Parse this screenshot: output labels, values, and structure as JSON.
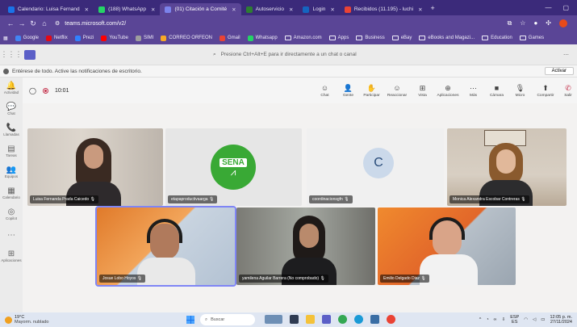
{
  "browser": {
    "tabs": [
      {
        "label": "Calendario: Luisa Fernand",
        "color": "#1a73e8"
      },
      {
        "label": "(188) WhatsApp",
        "color": "#25d366"
      },
      {
        "label": "(01) Citación a Comité",
        "color": "#5b5fc7",
        "active": true
      },
      {
        "label": "Autoservicio",
        "color": "#2e7d32"
      },
      {
        "label": "Login",
        "color": "#1565c0"
      },
      {
        "label": "Recibidos (11.195) - luchi",
        "color": "#ea4335"
      }
    ],
    "url": "teams.microsoft.com/v2/",
    "bookmarks": [
      {
        "label": "Google",
        "color": "#4285f4"
      },
      {
        "label": "Netflix",
        "color": "#e50914"
      },
      {
        "label": "Prezi",
        "color": "#3181ff"
      },
      {
        "label": "YouTube",
        "color": "#ff0000"
      },
      {
        "label": "SIMI",
        "color": "#9e9e9e"
      },
      {
        "label": "CORREO ORFEON",
        "color": "#f9a825"
      },
      {
        "label": "Gmail",
        "color": "#ea4335"
      },
      {
        "label": "Whatsapp",
        "color": "#25d366"
      },
      {
        "label": "Amazon.com",
        "folder": true
      },
      {
        "label": "Apps",
        "folder": true
      },
      {
        "label": "Business",
        "folder": true
      },
      {
        "label": "eBay",
        "folder": true
      },
      {
        "label": "eBooks and Magazi...",
        "folder": true
      },
      {
        "label": "Education",
        "folder": true
      },
      {
        "label": "Games",
        "folder": true
      }
    ]
  },
  "teams": {
    "search_placeholder": "Presione Ctrl+Alt+E para ir directamente a un chat o canal",
    "notice": "Entérese de todo. Active las notificaciones de escritorio.",
    "activate_label": "Activar",
    "rail": [
      {
        "label": "Actividad",
        "icon": "bell-icon",
        "glyph": "🔔"
      },
      {
        "label": "Chat",
        "icon": "chat-icon",
        "glyph": "💬"
      },
      {
        "label": "Llamadas",
        "icon": "phone-icon",
        "glyph": "📞"
      },
      {
        "label": "Tareas",
        "icon": "tasks-icon",
        "glyph": "▤"
      },
      {
        "label": "Equipos",
        "icon": "teams-icon",
        "glyph": "👥"
      },
      {
        "label": "Calendario",
        "icon": "calendar-icon",
        "glyph": "▦"
      },
      {
        "label": "Copilot",
        "icon": "copilot-icon",
        "glyph": "◎"
      },
      {
        "label": "",
        "icon": "more-icon",
        "glyph": "⋯"
      },
      {
        "label": "Aplicaciones",
        "icon": "apps-icon",
        "glyph": "⊞"
      }
    ],
    "meeting": {
      "timer": "10:01",
      "tools": [
        {
          "label": "Chat",
          "icon": "chat-icon",
          "glyph": "☺"
        },
        {
          "label": "Gente",
          "icon": "people-icon",
          "glyph": "👤"
        },
        {
          "label": "Participar",
          "icon": "hand-icon",
          "glyph": "✋"
        },
        {
          "label": "Reaccionar",
          "icon": "react-icon",
          "glyph": "☺"
        },
        {
          "label": "Vista",
          "icon": "view-icon",
          "glyph": "⊞"
        },
        {
          "label": "Aplicaciones",
          "icon": "apps-icon",
          "glyph": "⊕"
        },
        {
          "label": "Más",
          "icon": "more-icon",
          "glyph": "⋯"
        },
        {
          "label": "Cámara",
          "icon": "camera-icon",
          "glyph": "■"
        },
        {
          "label": "Micro",
          "icon": "mic-icon",
          "glyph": "🎙"
        },
        {
          "label": "Compartir",
          "icon": "share-icon",
          "glyph": "⬆"
        },
        {
          "label": "Salir",
          "icon": "leave-icon",
          "glyph": "✆"
        }
      ]
    },
    "participants": [
      {
        "name": "Luisa Fernanda Prada Caicedo"
      },
      {
        "name": "etapaproductivaarga"
      },
      {
        "name": "coordinacionsgfn",
        "initial": "C"
      },
      {
        "name": "Monica Alexandra Escobar Contreras"
      },
      {
        "name": "Josue Lobo Hoyos"
      },
      {
        "name": "yamilena Aguilar Barrera (No comprobado)"
      },
      {
        "name": "Emilio Delgado Diaz"
      }
    ],
    "sena_logo_text": "SENA"
  },
  "taskbar": {
    "weather_temp": "19°C",
    "weather_desc": "Mayorm. nublado",
    "search_label": "Buscar",
    "lang": "ESP",
    "lang2": "ES",
    "time": "12:05 p. m.",
    "date": "27/11/2024"
  }
}
